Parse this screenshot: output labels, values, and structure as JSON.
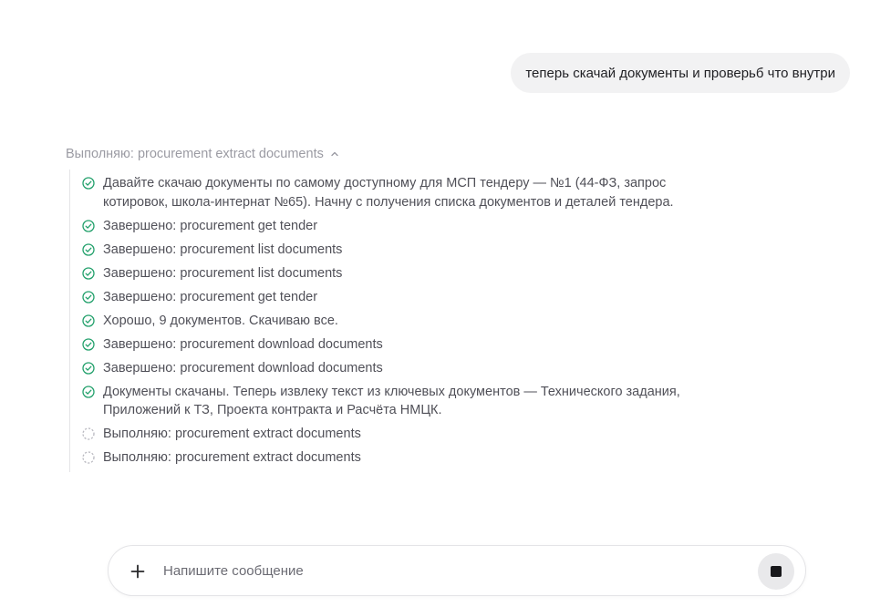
{
  "user_message": "теперь скачай документы и проверьб что внутри",
  "steps_header": {
    "label": "Выполняю: procurement extract documents",
    "expanded": true
  },
  "steps": [
    {
      "status": "done",
      "icon": "check-circle-icon",
      "text": "Давайте скачаю документы по самому доступному для МСП тендеру — №1 (44-ФЗ, запрос котировок, школа-интернат №65). Начну с получения списка документов и деталей тендера."
    },
    {
      "status": "done",
      "icon": "check-circle-icon",
      "text": "Завершено: procurement get tender"
    },
    {
      "status": "done",
      "icon": "check-circle-icon",
      "text": "Завершено: procurement list documents"
    },
    {
      "status": "done",
      "icon": "check-circle-icon",
      "text": "Завершено: procurement list documents"
    },
    {
      "status": "done",
      "icon": "check-circle-icon",
      "text": "Завершено: procurement get tender"
    },
    {
      "status": "done",
      "icon": "check-circle-icon",
      "text": "Хорошо, 9 документов. Скачиваю все."
    },
    {
      "status": "done",
      "icon": "check-circle-icon",
      "text": "Завершено: procurement download documents"
    },
    {
      "status": "done",
      "icon": "check-circle-icon",
      "text": "Завершено: procurement download documents"
    },
    {
      "status": "done",
      "icon": "check-circle-icon",
      "text": "Документы скачаны. Теперь извлеку текст из ключевых документов — Технического задания, Приложений к ТЗ, Проекта контракта и Расчёта НМЦК."
    },
    {
      "status": "running",
      "icon": "loading-circle-icon",
      "text": "Выполняю: procurement extract documents"
    },
    {
      "status": "running",
      "icon": "loading-circle-icon",
      "text": "Выполняю: procurement extract documents"
    }
  ],
  "composer": {
    "placeholder": "Напишите сообщение",
    "value": ""
  },
  "colors": {
    "check": "#22a06b",
    "pending": "#b9b9c0",
    "bubble": "#f2f2f3"
  }
}
